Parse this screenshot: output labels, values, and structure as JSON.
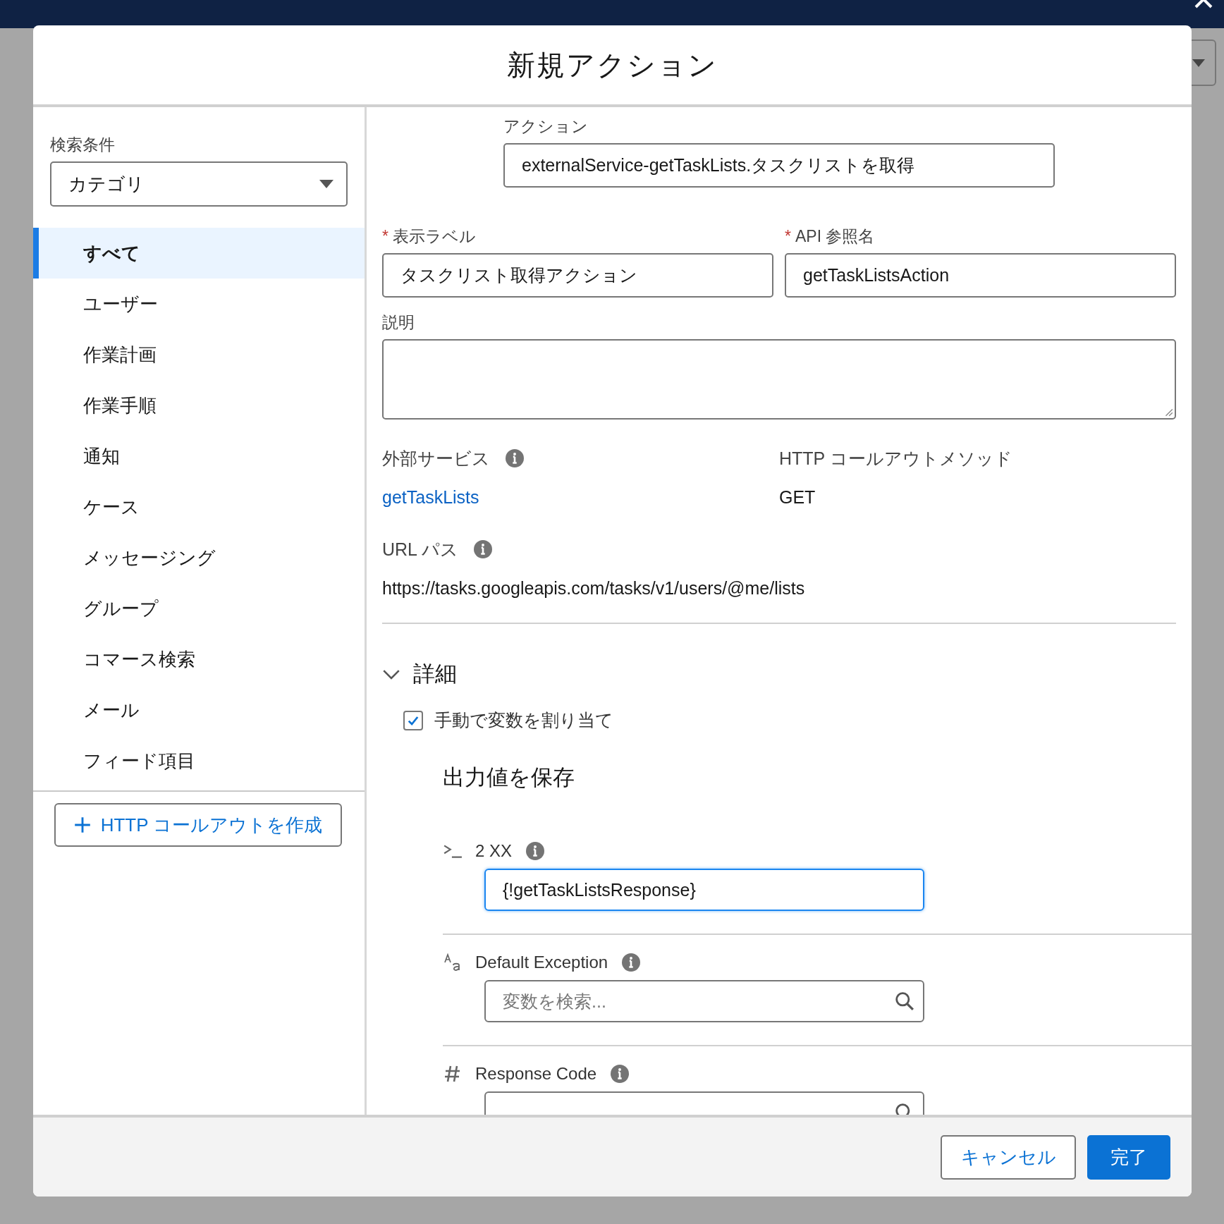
{
  "modal": {
    "title": "新規アクション"
  },
  "sidebar": {
    "filter_label": "検索条件",
    "filter_value": "カテゴリ",
    "items": [
      {
        "label": "すべて",
        "selected": true
      },
      {
        "label": "ユーザー",
        "selected": false
      },
      {
        "label": "作業計画",
        "selected": false
      },
      {
        "label": "作業手順",
        "selected": false
      },
      {
        "label": "通知",
        "selected": false
      },
      {
        "label": "ケース",
        "selected": false
      },
      {
        "label": "メッセージング",
        "selected": false
      },
      {
        "label": "グループ",
        "selected": false
      },
      {
        "label": "コマース検索",
        "selected": false
      },
      {
        "label": "メール",
        "selected": false
      },
      {
        "label": "フィード項目",
        "selected": false
      }
    ],
    "create_button": "HTTP コールアウトを作成"
  },
  "form": {
    "action": {
      "label": "アクション",
      "value": "externalService-getTaskLists.タスクリストを取得"
    },
    "fields": [
      {
        "label": "表示ラベル",
        "required_mark": "*",
        "value": "タスクリスト取得アクション"
      },
      {
        "label": "API 参照名",
        "required_mark": "*",
        "value": "getTaskListsAction"
      }
    ],
    "description": {
      "label": "説明"
    },
    "info": [
      {
        "label": "外部サービス",
        "info": true,
        "value": "getTaskLists",
        "kind": "link"
      },
      {
        "label": "HTTP コールアウトメソッド",
        "info": false,
        "value": "GET",
        "kind": "text"
      }
    ],
    "url": {
      "label": "URL パス",
      "info": true,
      "value": "https://tasks.googleapis.com/tasks/v1/users/@me/lists"
    }
  },
  "details": {
    "title": "詳細",
    "expanded": true,
    "manual": {
      "label": "手動で変数を割り当て",
      "checked": true
    },
    "output_title": "出力値を保存",
    "outputs": [
      {
        "kind": "object",
        "label": "2 XX",
        "value": "{!getTaskListsResponse}",
        "focused": true
      },
      {
        "kind": "text",
        "label": "Default Exception",
        "placeholder": "変数を検索...",
        "focused": false
      },
      {
        "kind": "number",
        "label": "Response Code",
        "focused": false
      }
    ]
  },
  "footer": {
    "buttons": [
      {
        "label": "キャンセル",
        "kind": "neutral"
      },
      {
        "label": "完了",
        "kind": "brand"
      }
    ]
  }
}
